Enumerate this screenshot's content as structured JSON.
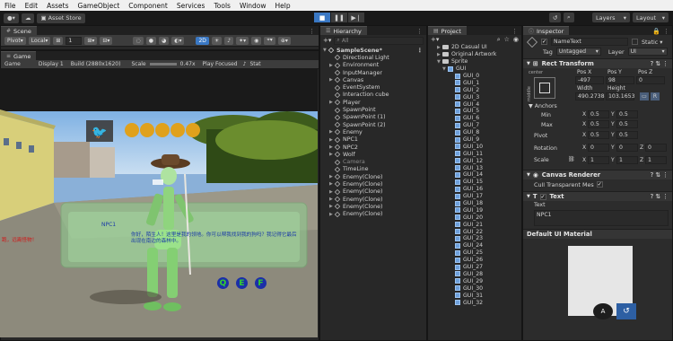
{
  "menu": [
    "File",
    "Edit",
    "Assets",
    "GameObject",
    "Component",
    "Services",
    "Tools",
    "Window",
    "Help"
  ],
  "toolbar": {
    "asset_store": "Asset Store",
    "layers": "Layers",
    "layout": "Layout"
  },
  "scene_panel": {
    "tab": "Scene",
    "pivot": "Pivot",
    "local": "Local",
    "grid_value": "1",
    "mode_2d": "2D"
  },
  "game_panel": {
    "tab": "Game",
    "display_mode": "Game",
    "display": "Display 1",
    "resolution": "Build (2880x1620)",
    "scale_label": "Scale",
    "scale_value": "0.47x",
    "play_focused": "Play Focused",
    "stats": "Stat",
    "npc_name": "NPC1",
    "npc_dialog": "你好，陌生人！这里是我的领地。你可以帮我找到我的狗吗？我记得它最后出现在南边的森林中。",
    "left_red_text": "跑，远离怪物！",
    "bottom_buttons": [
      "Q",
      "E",
      "F"
    ]
  },
  "hierarchy": {
    "tab": "Hierarchy",
    "search_placeholder": "All",
    "scene": "SampleScene*",
    "items": [
      {
        "name": "Directional Light",
        "dim": false,
        "arrow": ""
      },
      {
        "name": "Environment",
        "dim": false,
        "arrow": "▶"
      },
      {
        "name": "InputManager",
        "dim": false,
        "arrow": ""
      },
      {
        "name": "Canvas",
        "dim": false,
        "arrow": "▶"
      },
      {
        "name": "EventSystem",
        "dim": false,
        "arrow": ""
      },
      {
        "name": "Interaction cube",
        "dim": false,
        "arrow": ""
      },
      {
        "name": "Player",
        "dim": false,
        "arrow": "▶"
      },
      {
        "name": "SpawnPoint",
        "dim": false,
        "arrow": ""
      },
      {
        "name": "SpawnPoint (1)",
        "dim": false,
        "arrow": ""
      },
      {
        "name": "SpawnPoint (2)",
        "dim": false,
        "arrow": ""
      },
      {
        "name": "Enemy",
        "dim": false,
        "arrow": "▶"
      },
      {
        "name": "NPC1",
        "dim": false,
        "arrow": "▶"
      },
      {
        "name": "NPC2",
        "dim": false,
        "arrow": "▶"
      },
      {
        "name": "Wolf",
        "dim": false,
        "arrow": "▶"
      },
      {
        "name": "Camera",
        "dim": true,
        "arrow": ""
      },
      {
        "name": "TimeLine",
        "dim": false,
        "arrow": ""
      },
      {
        "name": "Enemy(Clone)",
        "dim": false,
        "arrow": "▶"
      },
      {
        "name": "Enemy(Clone)",
        "dim": false,
        "arrow": "▶"
      },
      {
        "name": "Enemy(Clone)",
        "dim": false,
        "arrow": "▶"
      },
      {
        "name": "Enemy(Clone)",
        "dim": false,
        "arrow": "▶"
      },
      {
        "name": "Enemy(Clone)",
        "dim": false,
        "arrow": "▶"
      },
      {
        "name": "Enemy(Clone)",
        "dim": false,
        "arrow": "▶"
      }
    ]
  },
  "project": {
    "tab": "Project",
    "folders": [
      "2D Casual UI",
      "Original Artwork",
      "Sprite",
      "GUI"
    ],
    "sprites": [
      "GUI_0",
      "GUI_1",
      "GUI_2",
      "GUI_3",
      "GUI_4",
      "GUI_5",
      "GUI_6",
      "GUI_7",
      "GUI_8",
      "GUI_9",
      "GUI_10",
      "GUI_11",
      "GUI_12",
      "GUI_13",
      "GUI_14",
      "GUI_15",
      "GUI_16",
      "GUI_17",
      "GUI_18",
      "GUI_19",
      "GUI_20",
      "GUI_21",
      "GUI_22",
      "GUI_23",
      "GUI_24",
      "GUI_25",
      "GUI_26",
      "GUI_27",
      "GUI_28",
      "GUI_29",
      "GUI_30",
      "GUI_31",
      "GUI_32"
    ]
  },
  "inspector": {
    "tab": "Inspector",
    "object_name": "NameText",
    "static_label": "Static",
    "tag_label": "Tag",
    "tag_value": "Untagged",
    "layer_label": "Layer",
    "layer_value": "UI",
    "rect_transform": {
      "title": "Rect Transform",
      "anchor_preset_top": "center",
      "anchor_preset_side": "middle",
      "pos_x_label": "Pos X",
      "pos_y_label": "Pos Y",
      "pos_z_label": "Pos Z",
      "pos_x": "-497",
      "pos_y": "98",
      "pos_z": "0",
      "width_label": "Width",
      "height_label": "Height",
      "width": "490.2738",
      "height": "103.1653",
      "anchors_label": "Anchors",
      "min_label": "Min",
      "max_label": "Max",
      "pivot_label": "Pivot",
      "min_x": "0.5",
      "min_y": "0.5",
      "max_x": "0.5",
      "max_y": "0.5",
      "pivot_x": "0.5",
      "pivot_y": "0.5",
      "rotation_label": "Rotation",
      "scale_label": "Scale",
      "rot_x": "0",
      "rot_y": "0",
      "rot_z": "0",
      "scale_x": "1",
      "scale_y": "1",
      "scale_z": "1"
    },
    "canvas_renderer": {
      "title": "Canvas Renderer",
      "cull_label": "Cull Transparent Mes"
    },
    "text": {
      "title": "Text",
      "text_label": "Text",
      "text_value": "NPC1"
    },
    "material": "Default UI Material"
  }
}
